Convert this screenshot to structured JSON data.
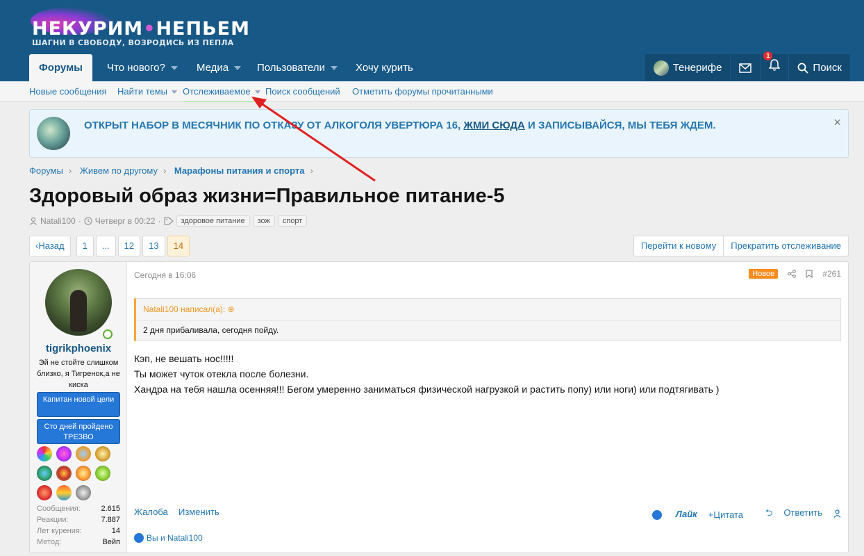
{
  "logo": {
    "title_part1": "НЕКУРИМ",
    "title_sep": "•",
    "title_part2": "НЕПЬЕМ",
    "subtitle": "ШАГНИ В СВОБОДУ, ВОЗРОДИСЬ ИЗ ПЕПЛА"
  },
  "nav": {
    "tabs": [
      {
        "label": "Форумы"
      },
      {
        "label": "Что нового?"
      },
      {
        "label": "Медиа"
      },
      {
        "label": "Пользователи"
      },
      {
        "label": "Хочу курить"
      }
    ],
    "user_label": "Тенерифе",
    "alerts_count": "1",
    "search_label": "Поиск"
  },
  "subnav": {
    "items": [
      {
        "label": "Новые сообщения"
      },
      {
        "label": "Найти темы"
      },
      {
        "label": "Отслеживаемое"
      },
      {
        "label": "Поиск сообщений"
      },
      {
        "label": "Отметить форумы прочитанными"
      }
    ]
  },
  "notice": {
    "text_before": "ОТКРЫТ НАБОР В МЕСЯЧНИК ПО ОТКАЗУ ОТ АЛКОГОЛЯ УВЕРТЮРА 16,",
    "link": "ЖМИ СЮДА",
    "text_after": "И ЗАПИСЫВАЙСЯ, МЫ ТЕБЯ ЖДЕМ.",
    "close": "×"
  },
  "breadcrumb": {
    "items": [
      "Форумы",
      "Живем по другому",
      "Марафоны питания и спорта"
    ],
    "sep": "›"
  },
  "thread": {
    "title": "Здоровый образ жизни=Правильное питание-5",
    "author": "Natali100",
    "date": "Четверг в 00:22",
    "tags": [
      "здоровое питание",
      "зож",
      "спорт"
    ]
  },
  "pager": {
    "prev": "Назад",
    "pages": [
      "1",
      "...",
      "12",
      "13",
      "14"
    ],
    "current": "14"
  },
  "thread_actions": {
    "goto_new": "Перейти к новому",
    "unwatch": "Прекратить отслеживание"
  },
  "post": {
    "user": {
      "name": "tigrikphoenix",
      "title": "Эй не стойте слишком близко, я Тигренок,а не киска",
      "banner1": "Капитан новой цели",
      "banner2": "Сто дней пройдено ТРЕЗВО",
      "stats": [
        {
          "label": "Сообщения:",
          "value": "2.615"
        },
        {
          "label": "Реакции:",
          "value": "7.887"
        },
        {
          "label": "Лет курения:",
          "value": "14"
        },
        {
          "label": "Метод:",
          "value": "Вейп"
        }
      ]
    },
    "date": "Сегодня в 16:06",
    "new_badge": "Новое",
    "number": "#261",
    "quote": {
      "author": "Natali100 написал(а):",
      "text": "2 дня прибаливала, сегодня пойду."
    },
    "body": [
      "Кэп, не вешать нос!!!!!",
      "Ты может чуток отекла после болезни.",
      "Хандра на тебя нашла осенняя!!! Бегом умеренно заниматься физической нагрузкой и растить попу) или ноги) или подтягивать )"
    ],
    "footer": {
      "report": "Жалоба",
      "edit": "Изменить",
      "like": "Лайк",
      "quote": "+Цитата",
      "reply": "Ответить"
    },
    "likes": "Вы и Natali100"
  },
  "colors": {
    "header": "#185886",
    "link": "#2577b1",
    "accent": "#f78c1f",
    "highlight": "#8ff57a",
    "arrow": "#e02020"
  }
}
